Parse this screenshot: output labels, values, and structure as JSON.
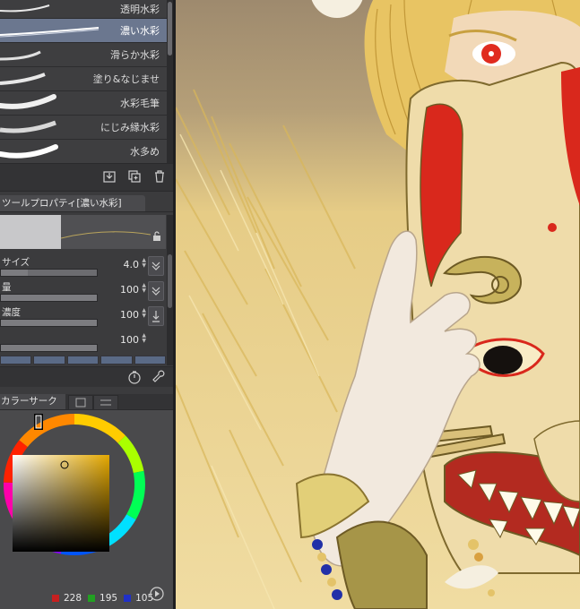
{
  "brushes": [
    {
      "label": "透明水彩",
      "selected": false
    },
    {
      "label": "濃い水彩",
      "selected": true
    },
    {
      "label": "滑らか水彩",
      "selected": false
    },
    {
      "label": "塗り&なじませ",
      "selected": false
    },
    {
      "label": "水彩毛筆",
      "selected": false
    },
    {
      "label": "にじみ縁水彩",
      "selected": false
    },
    {
      "label": "水多め",
      "selected": false
    }
  ],
  "tool_property": {
    "title": "ツールプロパティ[濃い水彩]",
    "rows": [
      {
        "label": "サイズ",
        "value": "4.0",
        "fill": 0.2
      },
      {
        "label": "量",
        "value": "100",
        "fill": 1.0
      },
      {
        "label": "濃度",
        "value": "100",
        "fill": 1.0
      },
      {
        "label": "",
        "value": "100",
        "fill": 1.0
      }
    ]
  },
  "color_panel": {
    "tab_label": "カラーサークル",
    "r": "228",
    "g": "195",
    "b": "105",
    "selected_color": "#e4c369"
  }
}
